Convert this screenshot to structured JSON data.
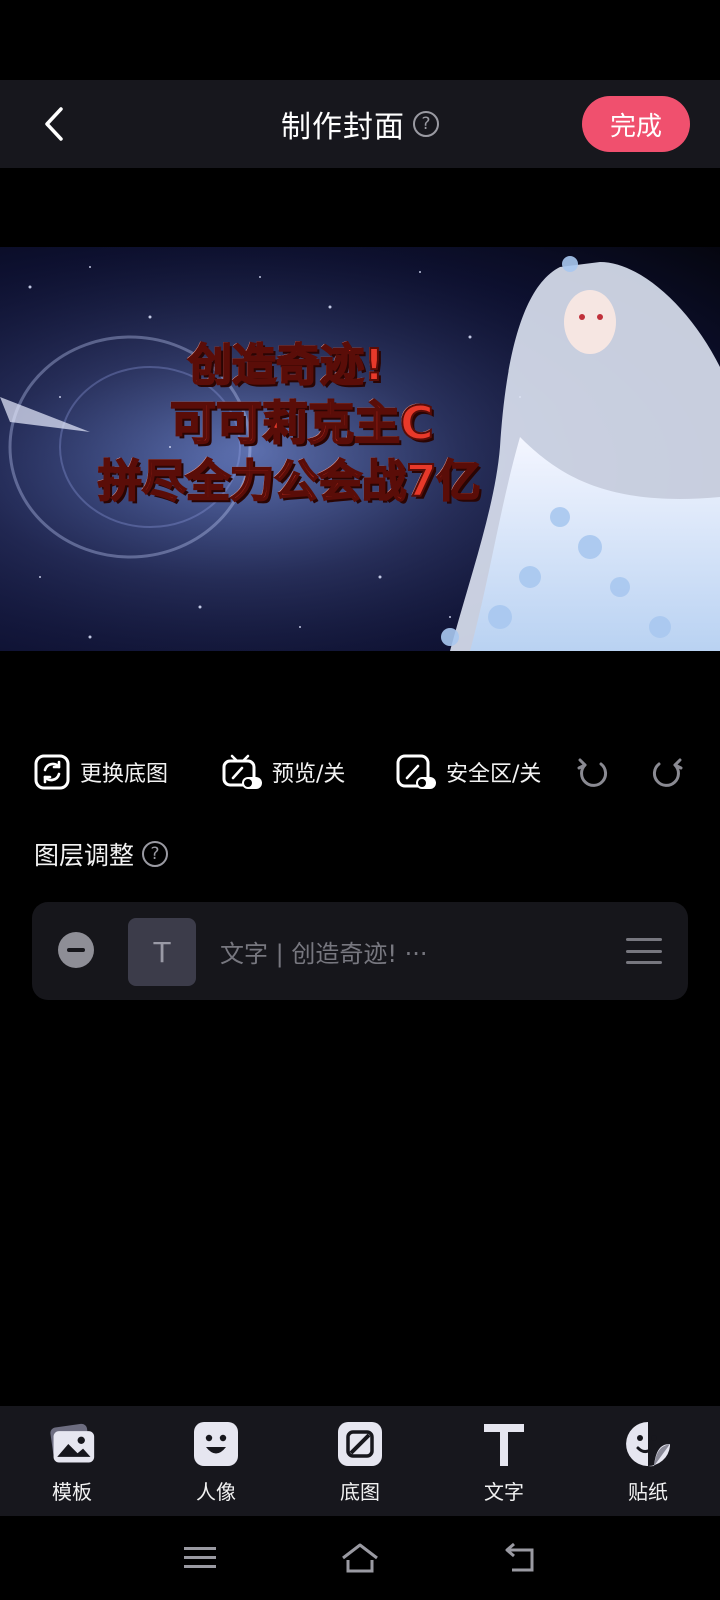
{
  "header": {
    "title": "制作封面",
    "help_glyph": "?",
    "done_label": "完成"
  },
  "cover": {
    "lines": [
      "创造奇迹!",
      "可可莉克主C",
      "拼尽全力公会战7亿"
    ]
  },
  "toolbar": {
    "replace_bg": "更换底图",
    "preview": "预览/关",
    "safe_zone": "安全区/关"
  },
  "layers": {
    "title": "图层调整",
    "help_glyph": "?",
    "items": [
      {
        "thumb_glyph": "T",
        "label": "文字 | 创造奇迹! ···"
      }
    ]
  },
  "bottom_tabs": [
    {
      "label": "模板",
      "icon": "template-icon"
    },
    {
      "label": "人像",
      "icon": "portrait-icon"
    },
    {
      "label": "底图",
      "icon": "background-icon"
    },
    {
      "label": "文字",
      "icon": "text-icon"
    },
    {
      "label": "贴纸",
      "icon": "sticker-icon"
    }
  ],
  "colors": {
    "accent": "#f0506e",
    "panel": "#16161b",
    "bar": "#17171d",
    "cover_text": "#e8392a"
  }
}
